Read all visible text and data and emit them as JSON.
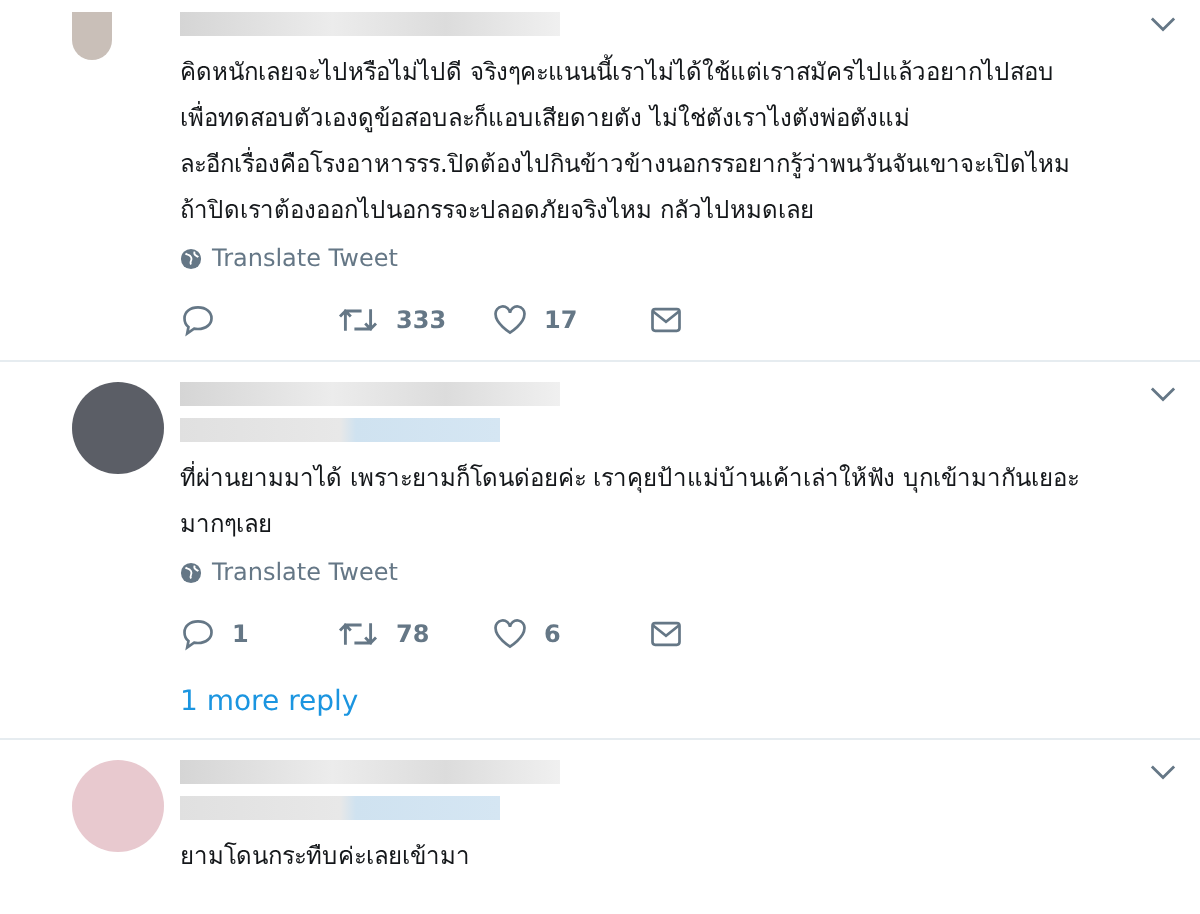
{
  "tweets": [
    {
      "text_lines": [
        "คิดหนักเลยจะไปหรือไม่ไปดี จริงๆคะแนนนี้เราไม่ได้ใช้แต่เราสมัครไปแล้วอยากไปสอบ",
        "เพื่อทดสอบตัวเองดูข้อสอบละก็แอบเสียดายตัง ไม่ใช่ตังเราไงตังพ่อตังแม่",
        "ละอีกเรื่องคือโรงอาหารรร.ปิดต้องไปกินข้าวข้างนอกรรอยากรู้ว่าพนวันจันเขาจะเปิดไหม",
        "ถ้าปิดเราต้องออกไปนอกรรจะปลอดภัยจริงไหม กลัวไปหมดเลย"
      ],
      "translate": "Translate Tweet",
      "actions": {
        "retweets": "333",
        "likes": "17"
      }
    },
    {
      "text_lines": [
        "ที่ผ่านยามมาได้ เพราะยามก็โดนด่อยค่ะ เราคุยป้าแม่บ้านเค้าเล่าให้ฟัง บุกเข้ามากันเยอะ",
        "มากๆเลย"
      ],
      "translate": "Translate Tweet",
      "actions": {
        "replies": "1",
        "retweets": "78",
        "likes": "6"
      },
      "more_replies": "1 more reply"
    },
    {
      "text_lines": [
        "ยามโดนกระทืบค่ะเลยเข้ามา"
      ]
    }
  ]
}
